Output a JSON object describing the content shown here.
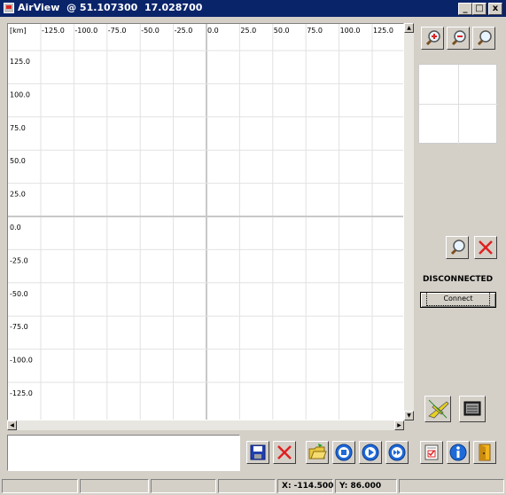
{
  "window": {
    "title": "AirView  @ 51.107300  17.028700",
    "minimize": "_",
    "maximize": "□",
    "close": "x"
  },
  "map": {
    "unit_label": "[km]",
    "x_ticks": [
      "-125.0",
      "-100.0",
      "-75.0",
      "-50.0",
      "-25.0",
      "0.0",
      "25.0",
      "50.0",
      "75.0",
      "100.0",
      "125.0"
    ],
    "y_ticks": [
      "125.0",
      "100.0",
      "75.0",
      "50.0",
      "25.0",
      "0.0",
      "-25.0",
      "-50.0",
      "-75.0",
      "-100.0",
      "-125.0"
    ]
  },
  "connection": {
    "status": "DISCONNECTED",
    "connect_label": "Connect"
  },
  "statusbar": {
    "x_readout": "X: -114.500",
    "y_readout": "Y: 86.000"
  },
  "icons": {
    "zoom_in": "zoom-in-icon",
    "zoom_out": "zoom-out-icon",
    "zoom_reset": "magnifier-icon",
    "save": "floppy-disk-icon",
    "close": "red-x-icon",
    "open": "folder-open-icon",
    "record": "record-icon",
    "play": "play-icon",
    "fast_forward": "fast-forward-icon",
    "aircraft": "aircraft-icon",
    "list": "list-icon",
    "settings": "checklist-icon",
    "info": "info-icon",
    "exit": "exit-door-icon"
  }
}
